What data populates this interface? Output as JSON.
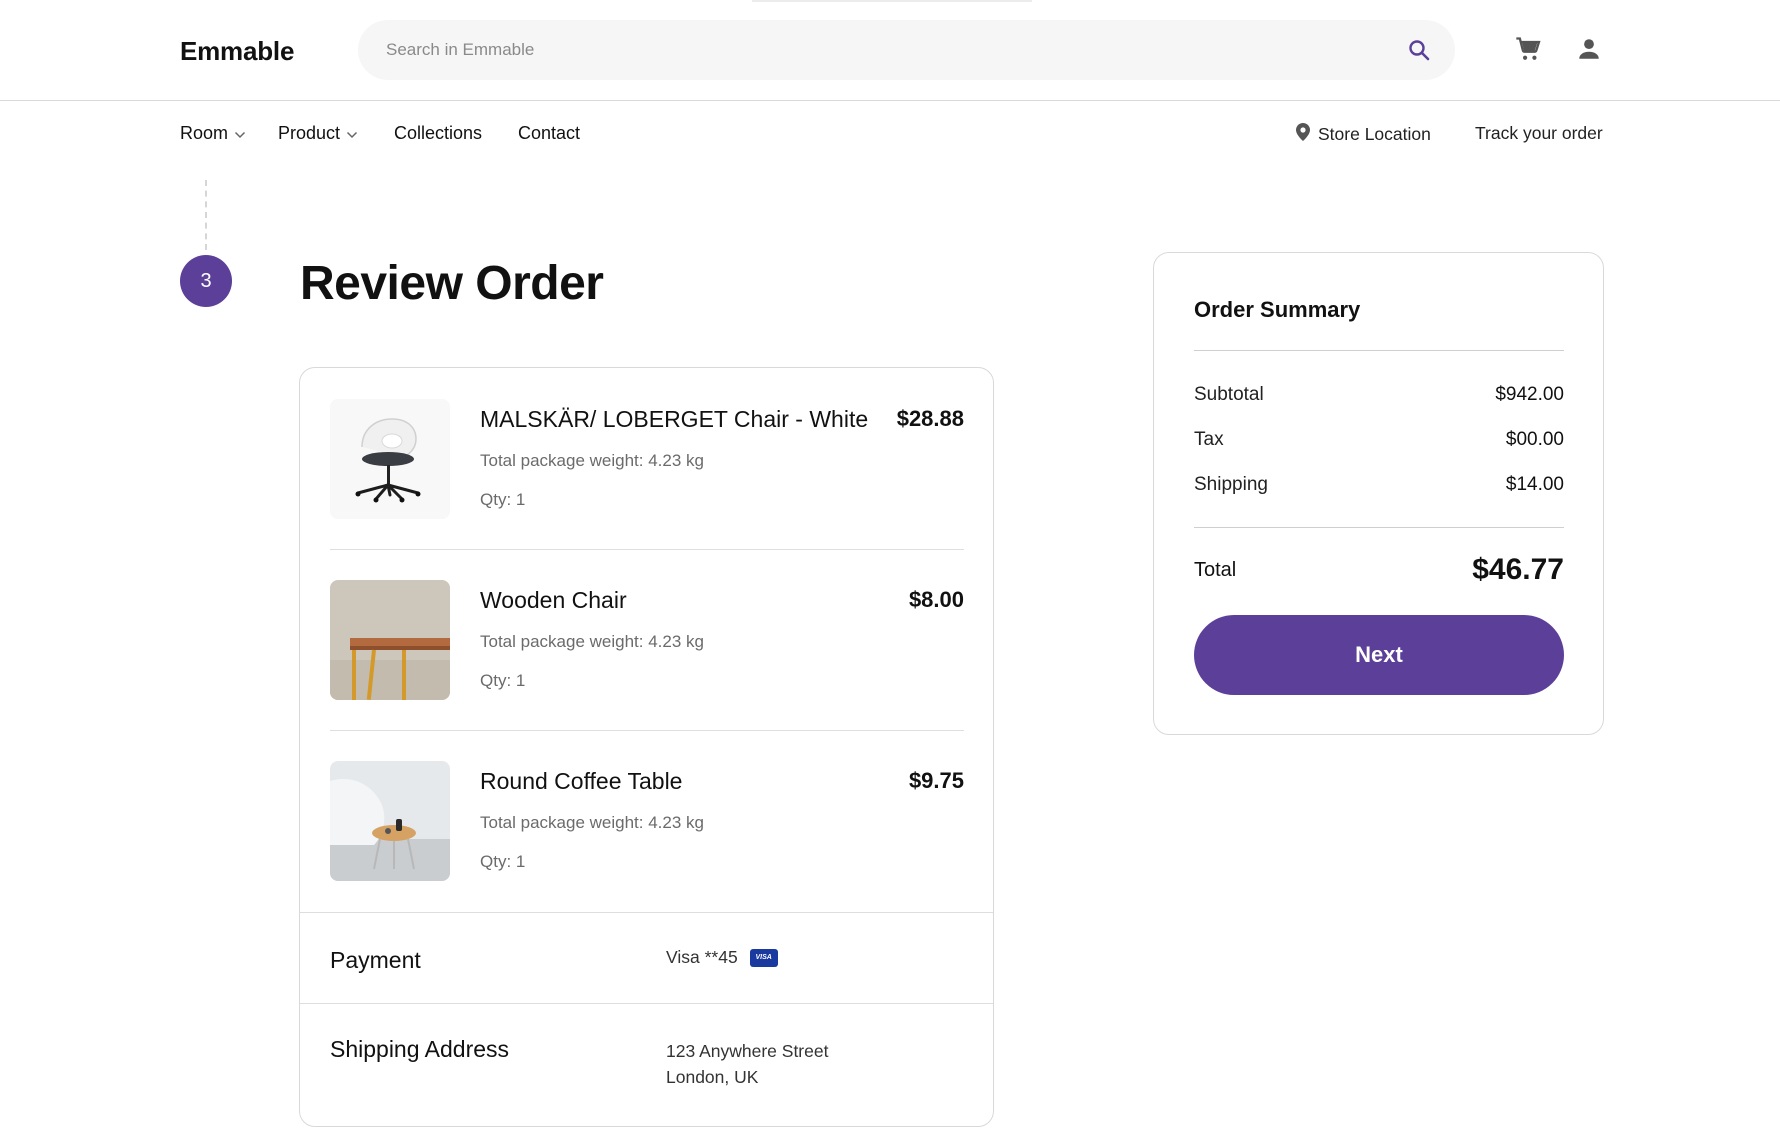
{
  "header": {
    "brand": "Emmable",
    "search_placeholder": "Search in Emmable",
    "icons": [
      "search-icon",
      "cart-icon",
      "user-icon"
    ]
  },
  "nav": {
    "items": [
      {
        "label": "Room",
        "has_dropdown": true
      },
      {
        "label": "Product",
        "has_dropdown": true
      },
      {
        "label": "Collections",
        "has_dropdown": false
      },
      {
        "label": "Contact",
        "has_dropdown": false
      }
    ],
    "store_location": "Store Location",
    "track_order": "Track your order"
  },
  "step": {
    "number": "3",
    "title": "Review Order"
  },
  "order": {
    "items": [
      {
        "name": "MALSKÄR/ LOBERGET Chair - White",
        "weight": "Total package weight: 4.23 kg",
        "qty": "Qty: 1",
        "price": "$28.88",
        "image": "office-chair-image"
      },
      {
        "name": "Wooden Chair",
        "weight": "Total package weight: 4.23 kg",
        "qty": "Qty: 1",
        "price": "$8.00",
        "image": "wooden-chair-image"
      },
      {
        "name": "Round Coffee Table",
        "weight": "Total package weight: 4.23 kg",
        "qty": "Qty: 1",
        "price": "$9.75",
        "image": "coffee-table-image"
      }
    ],
    "payment": {
      "label": "Payment",
      "value": "Visa **45",
      "badge": "VISA"
    },
    "shipping": {
      "label": "Shipping Address",
      "line1": "123 Anywhere Street",
      "line2": "London, UK"
    }
  },
  "summary": {
    "title": "Order Summary",
    "subtotal_label": "Subtotal",
    "subtotal": "$942.00",
    "tax_label": "Tax",
    "tax": "$00.00",
    "shipping_label": "Shipping",
    "shipping": "$14.00",
    "total_label": "Total",
    "total": "$46.77",
    "next_label": "Next"
  },
  "colors": {
    "accent": "#5b3f99",
    "border": "#d9d9d9",
    "muted_text": "#6b6b6b"
  }
}
